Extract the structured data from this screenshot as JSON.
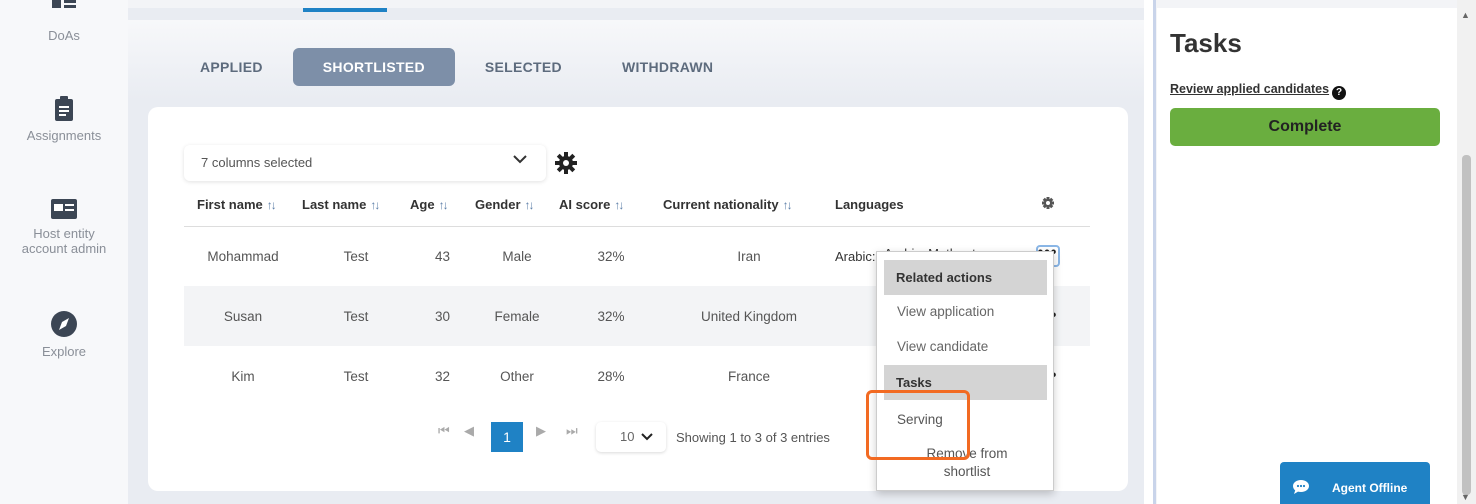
{
  "sidebar": {
    "items": [
      {
        "label": "DoAs",
        "icon": "doas-icon"
      },
      {
        "label": "Assignments",
        "icon": "clipboard-icon"
      },
      {
        "label": "Host entity account admin",
        "icon": "id-card-icon"
      },
      {
        "label": "Explore",
        "icon": "compass-icon"
      }
    ]
  },
  "tabs": [
    {
      "label": "APPLIED",
      "active": false
    },
    {
      "label": "SHORTLISTED",
      "active": true
    },
    {
      "label": "SELECTED",
      "active": false
    },
    {
      "label": "WITHDRAWN",
      "active": false
    }
  ],
  "columns_select": {
    "value": "7 columns selected"
  },
  "table": {
    "headers": [
      "First name",
      "Last name",
      "Age",
      "Gender",
      "AI score",
      "Current nationality",
      "Languages"
    ],
    "rows": [
      {
        "first_name": "Mohammad",
        "last_name": "Test",
        "age": "43",
        "gender": "Male",
        "ai_score": "32%",
        "nationality": "Iran",
        "languages": "Arabic: Mother tongue"
      },
      {
        "first_name": "Susan",
        "last_name": "Test",
        "age": "30",
        "gender": "Female",
        "ai_score": "32%",
        "nationality": "United Kingdom",
        "languages": ""
      },
      {
        "first_name": "Kim",
        "last_name": "Test",
        "age": "32",
        "gender": "Other",
        "ai_score": "28%",
        "nationality": "France",
        "languages": ""
      }
    ],
    "row_action": "•••"
  },
  "pagination": {
    "current_page": "1",
    "page_size": "10",
    "info": "Showing 1 to 3 of 3 entries"
  },
  "menu": {
    "related_actions_header": "Related actions",
    "view_application": "View application",
    "view_candidate": "View candidate",
    "tasks_header": "Tasks",
    "serving": "Serving",
    "remove_from_shortlist": "Remove from shortlist"
  },
  "right_panel": {
    "title": "Tasks",
    "review_link": "Review applied candidates",
    "help": "?",
    "complete_button": "Complete"
  },
  "chat": {
    "label": "Agent Offline"
  },
  "colors": {
    "accent": "#1f82c5",
    "active_tab": "#7d8fa8",
    "complete": "#6aae3f",
    "highlight": "#f26a22"
  }
}
